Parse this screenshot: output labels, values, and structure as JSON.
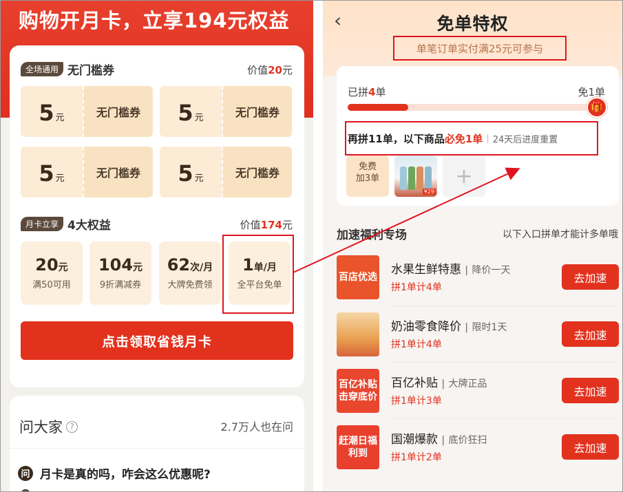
{
  "left": {
    "hero_title": "购物开月卡，立享194元权益",
    "coupon_section": {
      "tag": "全场通用",
      "name": "无门槛券",
      "value_prefix": "价值",
      "value_num": "20",
      "value_unit": "元",
      "coupons": [
        {
          "amount": "5",
          "unit": "元",
          "label": "无门槛券"
        },
        {
          "amount": "5",
          "unit": "元",
          "label": "无门槛券"
        },
        {
          "amount": "5",
          "unit": "元",
          "label": "无门槛券"
        },
        {
          "amount": "5",
          "unit": "元",
          "label": "无门槛券"
        }
      ]
    },
    "benefit_section": {
      "tag": "月卡立享",
      "name": "4大权益",
      "value_prefix": "价值",
      "value_num": "174",
      "value_unit": "元",
      "benefits": [
        {
          "value": "20",
          "unit": "元",
          "desc": "满50可用"
        },
        {
          "value": "104",
          "unit": "元",
          "desc": "9折满减券"
        },
        {
          "value": "62",
          "unit": "次/月",
          "desc": "大牌免费领"
        },
        {
          "value": "1",
          "unit": "单/月",
          "desc": "全平台免单"
        }
      ]
    },
    "claim_button": "点击领取省钱月卡",
    "ask": {
      "title": "问大家",
      "help_icon": "?",
      "count": "2.7万人也在问",
      "question_icon": "问",
      "question": "月卡是真的吗，咋会这么优惠呢?"
    }
  },
  "right": {
    "back_icon": "chevron-left-icon",
    "title": "免单特权",
    "subtitle": "单笔订单实付满25元可参与",
    "progress": {
      "got_prefix": "已拼",
      "got_num": "4",
      "got_suffix": "单",
      "goal": "免1单",
      "fraction": 0.25,
      "hint_prefix": "再拼11单，以下商品",
      "hint_red": "必免1单",
      "hint_sep": "|",
      "hint_reset": "24天后进度重置",
      "free_line1": "免费",
      "free_line2": "加3单",
      "goods_price": "¥29",
      "add_icon": "+"
    },
    "zone": {
      "title": "加速福利专场",
      "note": "以下入口拼单才能计多单哦",
      "items": [
        {
          "img_text": "百店优选",
          "name": "水果生鲜特惠",
          "sep": "|",
          "tagline": "降价一天",
          "count": "拼1单计4单",
          "button": "去加速",
          "color": "#e9542a"
        },
        {
          "img_text": "",
          "name": "奶油零食降价",
          "sep": "|",
          "tagline": "限时1天",
          "count": "拼1单计4单",
          "button": "去加速",
          "color": "#f0b060"
        },
        {
          "img_text": "百亿补贴击穿底价",
          "name": "百亿补贴",
          "sep": "|",
          "tagline": "大牌正品",
          "count": "拼1单计3单",
          "button": "去加速",
          "color": "#e9462e"
        },
        {
          "img_text": "赶潮日福利到",
          "name": "国潮爆款",
          "sep": "|",
          "tagline": "底价狂扫",
          "count": "拼1单计2单",
          "button": "去加速",
          "color": "#e9402e"
        }
      ]
    }
  },
  "colors": {
    "accent": "#e2321e",
    "highlight_box": "#e0141e"
  }
}
